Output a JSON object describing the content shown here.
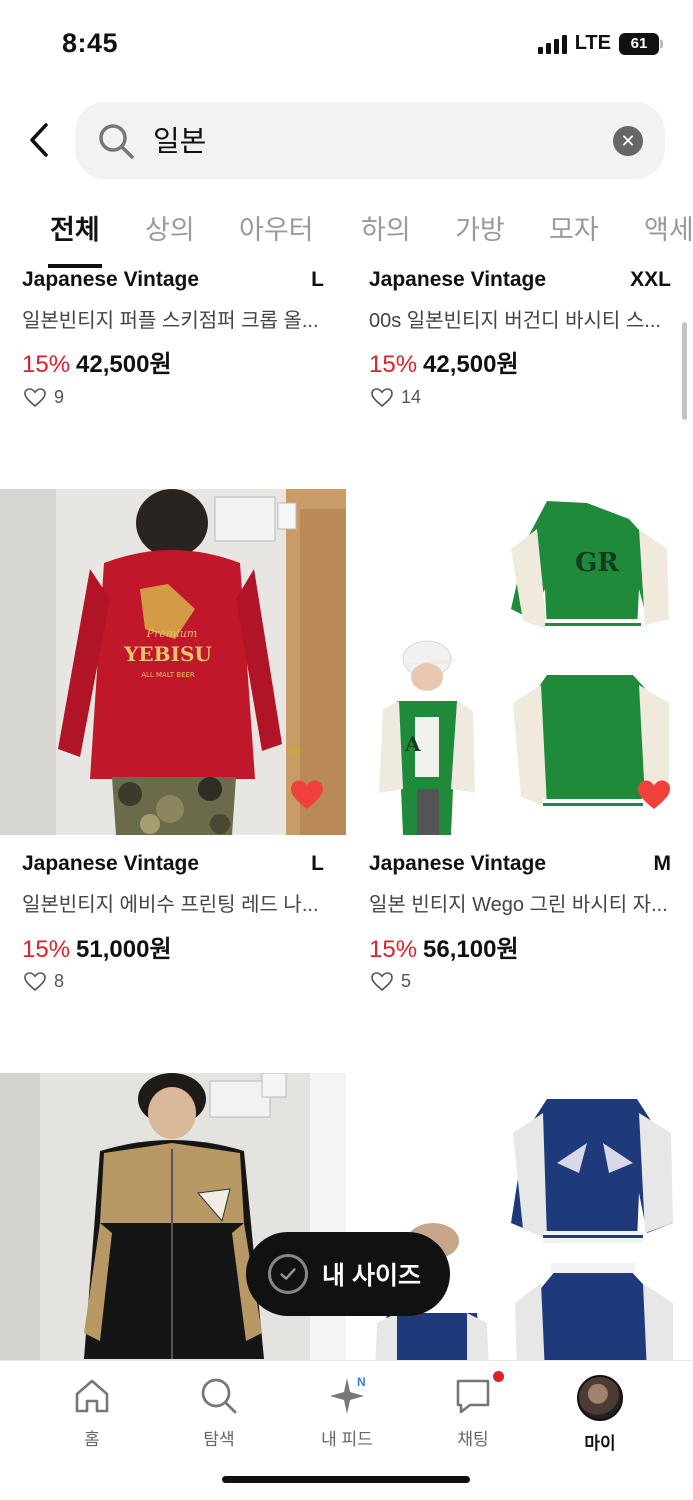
{
  "status": {
    "time": "8:45",
    "network": "LTE",
    "battery": "61"
  },
  "search": {
    "query": "일본",
    "placeholder": ""
  },
  "tabs": [
    "전체",
    "상의",
    "아우터",
    "하의",
    "가방",
    "모자",
    "액세"
  ],
  "products": [
    {
      "brand": "Japanese Vintage",
      "size": "L",
      "title": "일본빈티지 퍼플 스키점퍼 크롭 올...",
      "discount": "15%",
      "price": "42,500원",
      "likes": "9",
      "liked": false
    },
    {
      "brand": "Japanese Vintage",
      "size": "XXL",
      "title": "00s 일본빈티지 버건디 바시티 스...",
      "discount": "15%",
      "price": "42,500원",
      "likes": "14",
      "liked": false
    },
    {
      "brand": "Japanese Vintage",
      "size": "L",
      "title": "일본빈티지 에비수 프린팅 레드 나...",
      "discount": "15%",
      "price": "51,000원",
      "likes": "8",
      "liked": true
    },
    {
      "brand": "Japanese Vintage",
      "size": "M",
      "title": "일본 빈티지 Wego 그린 바시티 자...",
      "discount": "15%",
      "price": "56,100원",
      "likes": "5",
      "liked": true
    }
  ],
  "image_text": {
    "premium": "Premium",
    "yebisu": "YEBISU",
    "malt": "ALL MALT BEER"
  },
  "floating": {
    "my_size_label": "내 사이즈"
  },
  "nav": {
    "home": "홈",
    "explore": "탐색",
    "feed": "내 피드",
    "feed_badge": "N",
    "chat": "채팅",
    "my": "마이"
  },
  "colors": {
    "discount": "#e0202a",
    "heart": "#f0403c",
    "accent": "#111111"
  }
}
